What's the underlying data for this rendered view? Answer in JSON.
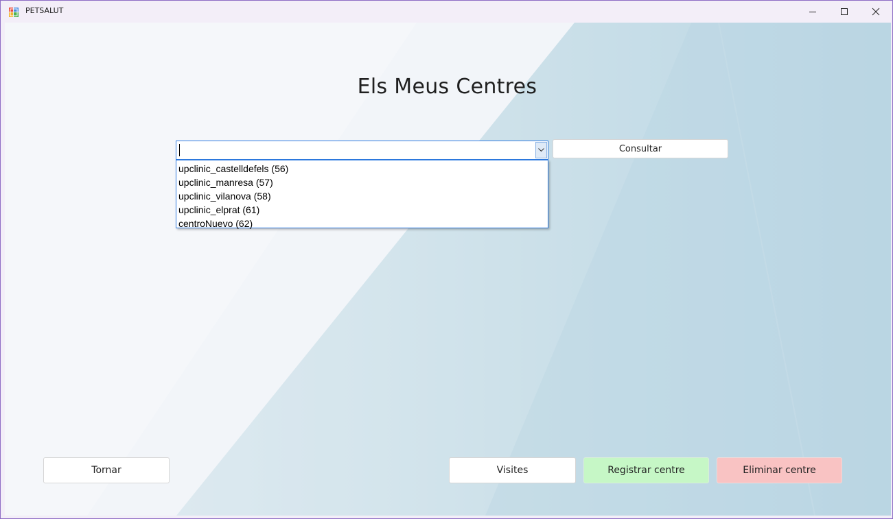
{
  "window": {
    "title": "PETSALUT",
    "controls": {
      "minimize": "minimize-icon",
      "maximize": "maximize-icon",
      "close": "close-icon"
    }
  },
  "page": {
    "heading": "Els Meus Centres"
  },
  "center_select": {
    "value": "",
    "options": [
      "upclinic_castelldefels (56)",
      "upclinic_manresa (57)",
      "upclinic_vilanova (58)",
      "upclinic_elprat (61)",
      "centroNuevo (62)"
    ]
  },
  "buttons": {
    "consultar": "Consultar",
    "tornar": "Tornar",
    "visites": "Visites",
    "registrar": "Registrar centre",
    "eliminar": "Eliminar centre"
  },
  "colors": {
    "accent": "#2d7ae0",
    "register_button": "#c6f7c6",
    "delete_button": "#f9c3c3",
    "window_border": "#8c6bc4"
  }
}
